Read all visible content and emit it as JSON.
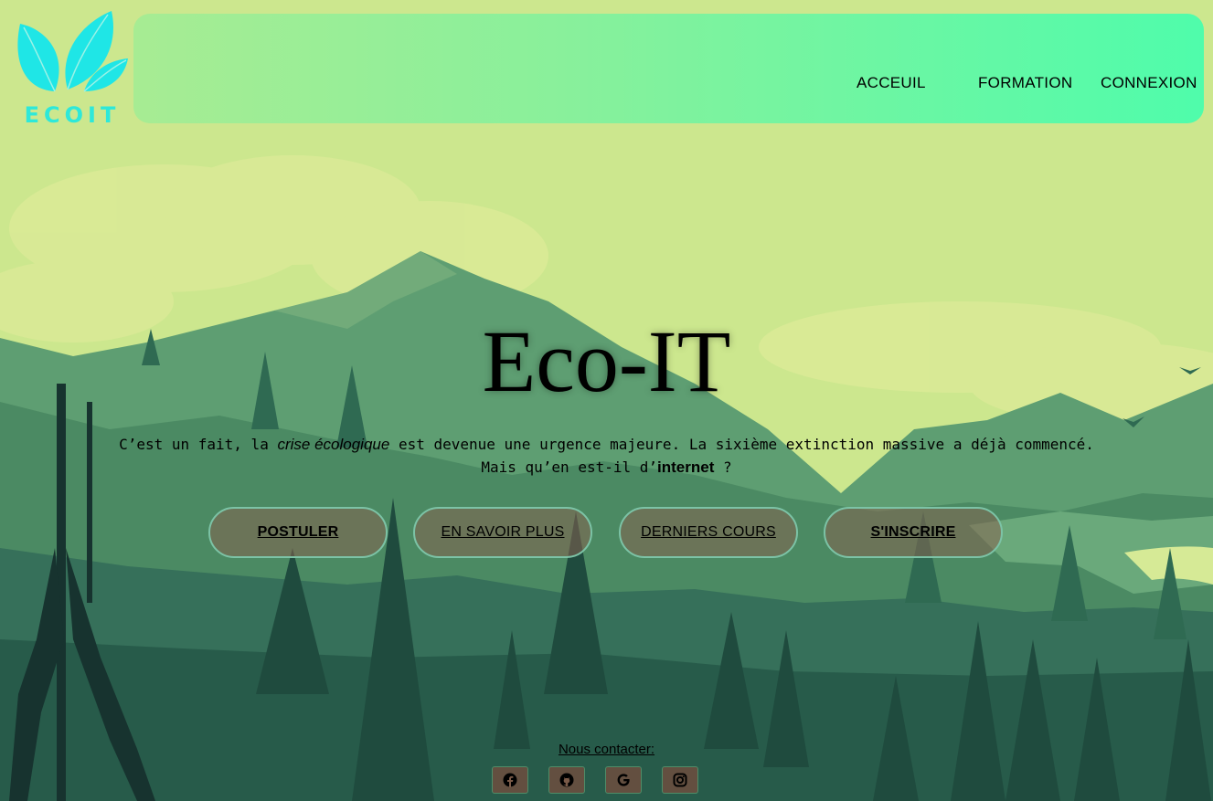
{
  "logo": {
    "text": "ECOIT"
  },
  "nav": {
    "items": [
      {
        "label": "ACCEUIL"
      },
      {
        "label": "FORMATION"
      },
      {
        "label": "CONNEXION"
      }
    ]
  },
  "hero": {
    "title": "Eco-IT",
    "line1_a": "C’est un fait, la ",
    "line1_em": "crise écologique",
    "line1_b": " est devenue une urgence majeure. La sixième extinction massive a déjà commencé.",
    "line2_a": "Mais qu’en est-il d’",
    "line2_strong": "internet",
    "line2_b": " ?"
  },
  "buttons": [
    {
      "label": "POSTULER"
    },
    {
      "label": "EN SAVOIR PLUS"
    },
    {
      "label": "DERNIERS COURS"
    },
    {
      "label": "S'INSCRIRE"
    }
  ],
  "footer": {
    "contact_label": "Nous contacter:",
    "socials": [
      "facebook-icon",
      "github-icon",
      "google-icon",
      "instagram-icon"
    ]
  },
  "colors": {
    "accent": "#2ee8d9",
    "nav_gradient_start": "#a7ec93",
    "nav_gradient_end": "#4ffcab",
    "sky": "#cce78e"
  }
}
